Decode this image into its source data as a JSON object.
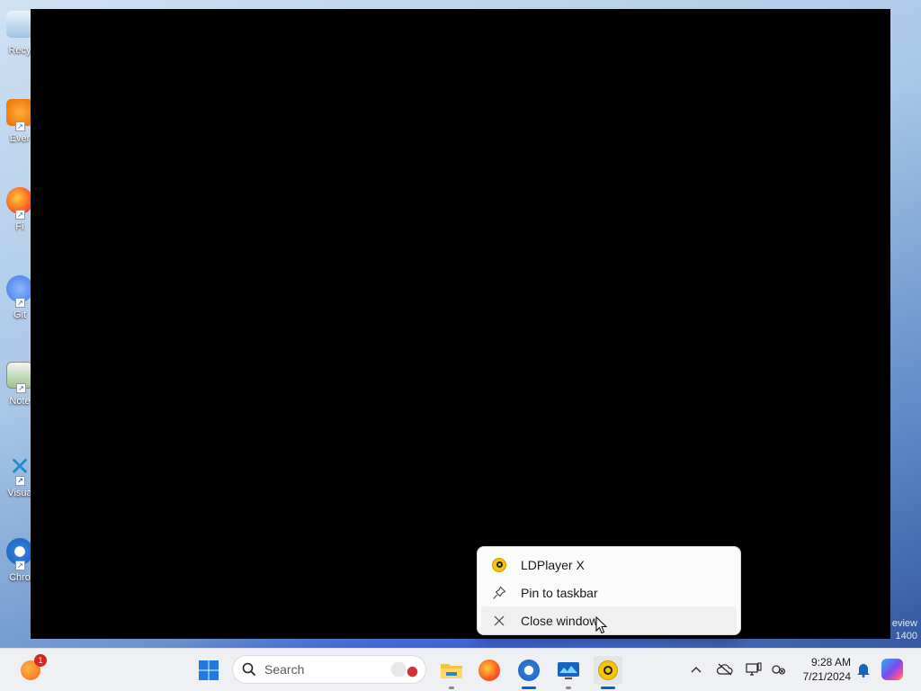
{
  "desktop": {
    "icons": [
      {
        "label": "Recy",
        "icon": "recycle-bin-icon"
      },
      {
        "label": "Ever",
        "icon": "everything-icon"
      },
      {
        "label": "Fi",
        "icon": "firefox-icon"
      },
      {
        "label": "Git",
        "icon": "git-icon"
      },
      {
        "label": "Note",
        "icon": "notepad-icon"
      },
      {
        "label": "Visua",
        "icon": "vscode-icon"
      },
      {
        "label": "Chro",
        "icon": "chrome-icon"
      }
    ],
    "watermark": [
      "eview",
      "1400"
    ]
  },
  "jump_menu": {
    "app_name": "LDPlayer X",
    "pin_label": "Pin to taskbar",
    "close_label": "Close window"
  },
  "taskbar": {
    "widgets_badge": "1",
    "search_placeholder": "Search"
  },
  "clock": {
    "time": "9:28 AM",
    "date": "7/21/2024"
  }
}
